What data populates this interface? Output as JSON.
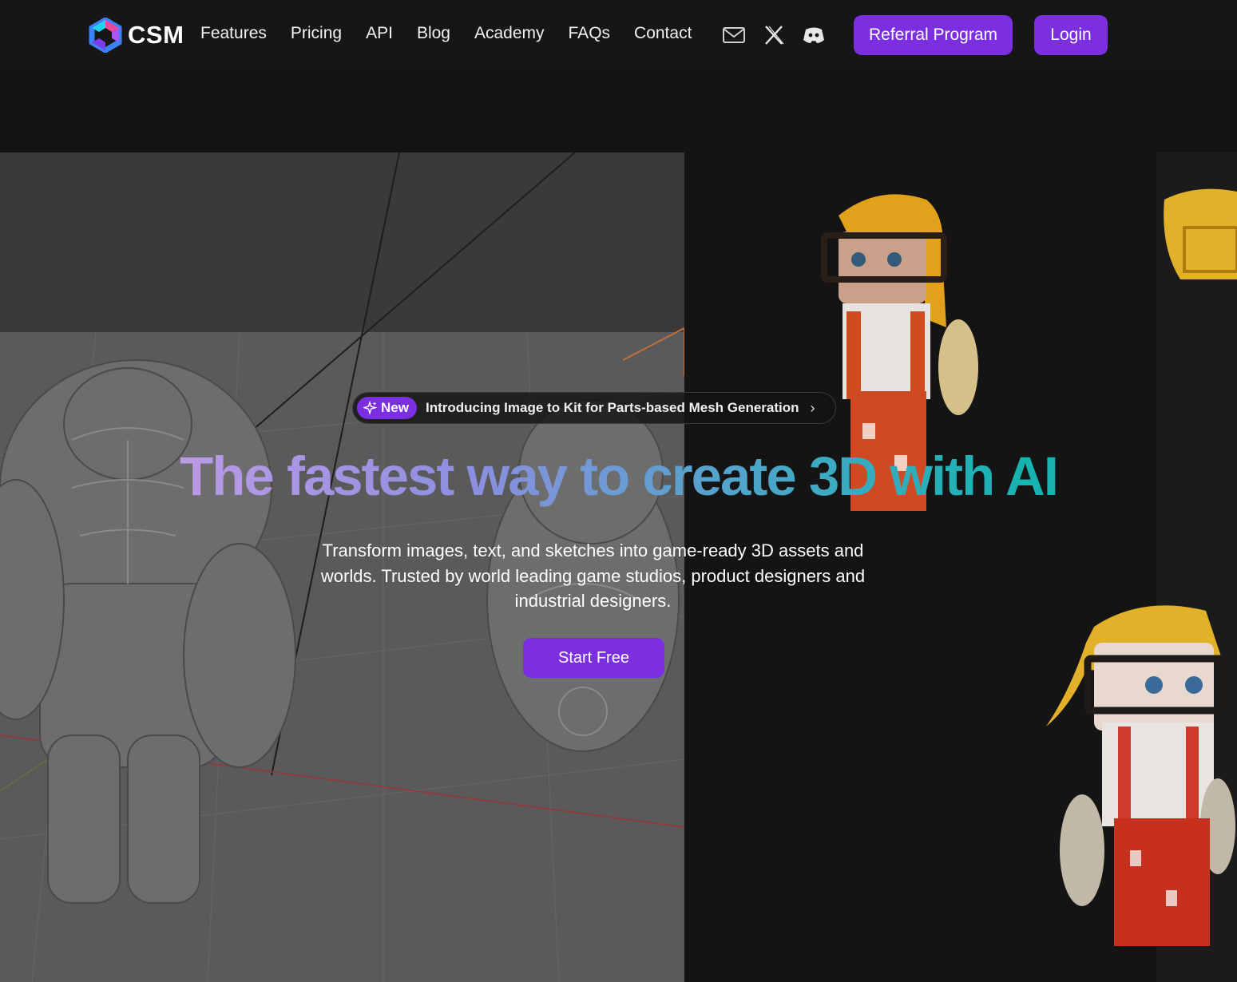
{
  "brand": {
    "name": "CSM"
  },
  "nav": {
    "links": [
      "Features",
      "Pricing",
      "API",
      "Blog",
      "Academy",
      "FAQs",
      "Contact"
    ],
    "icons": [
      "mail-icon",
      "x-twitter-icon",
      "discord-icon"
    ],
    "referral_label": "Referral Program",
    "login_label": "Login"
  },
  "announcement": {
    "badge": "New",
    "text": "Introducing Image to Kit for Parts-based Mesh Generation"
  },
  "hero": {
    "title": "The fastest way to create 3D with AI",
    "subtitle": "Transform  images, text, and sketches into game-ready 3D assets and worlds. Trusted by world leading game studios, product designers and industrial designers.",
    "cta_label": "Start Free"
  },
  "colors": {
    "accent": "#7b2fe0",
    "background": "#141414",
    "title_gradient": [
      "#c09be8",
      "#8c8fdf",
      "#4aa6c8",
      "#16b3b0"
    ]
  }
}
